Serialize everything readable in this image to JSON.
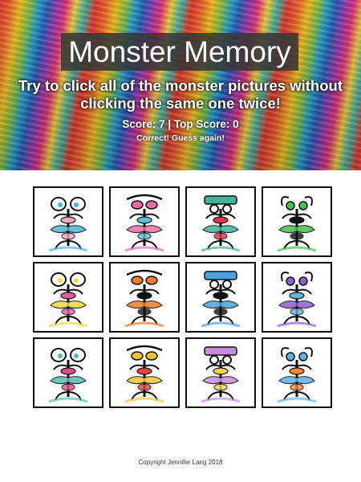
{
  "header": {
    "title": "Monster Memory",
    "instructions": "Try to click all of the monster pictures without clicking the same one twice!",
    "score_label": "Score: ",
    "score": "7",
    "separator": " | ",
    "top_score_label": "Top Score: ",
    "top_score": "0",
    "status_message": "Correct! Guess again!"
  },
  "cards": [
    {
      "name": "monster-card-1",
      "accent": "#4bb8d8",
      "accent2": "#f3a6c8"
    },
    {
      "name": "monster-card-2",
      "accent": "#ef6aa6",
      "accent2": "#56c2d8"
    },
    {
      "name": "monster-card-3",
      "accent": "#3fb49a",
      "accent2": "#e0334c"
    },
    {
      "name": "monster-card-4",
      "accent": "#45c24a",
      "accent2": "#111111"
    },
    {
      "name": "monster-card-5",
      "accent": "#f4d83a",
      "accent2": "#e05fa0"
    },
    {
      "name": "monster-card-6",
      "accent": "#f27b2a",
      "accent2": "#111111"
    },
    {
      "name": "monster-card-7",
      "accent": "#4aa3df",
      "accent2": "#111111"
    },
    {
      "name": "monster-card-8",
      "accent": "#8d5fd1",
      "accent2": "#5fb7e0"
    },
    {
      "name": "monster-card-9",
      "accent": "#4fc0b0",
      "accent2": "#e84a8a"
    },
    {
      "name": "monster-card-10",
      "accent": "#f0c531",
      "accent2": "#e8453c"
    },
    {
      "name": "monster-card-11",
      "accent": "#c98be0",
      "accent2": "#f5d14a"
    },
    {
      "name": "monster-card-12",
      "accent": "#5ab6e6",
      "accent2": "#f08b2e"
    }
  ],
  "footer": {
    "copyright": "Copyright Jennifer Lang 2018"
  }
}
